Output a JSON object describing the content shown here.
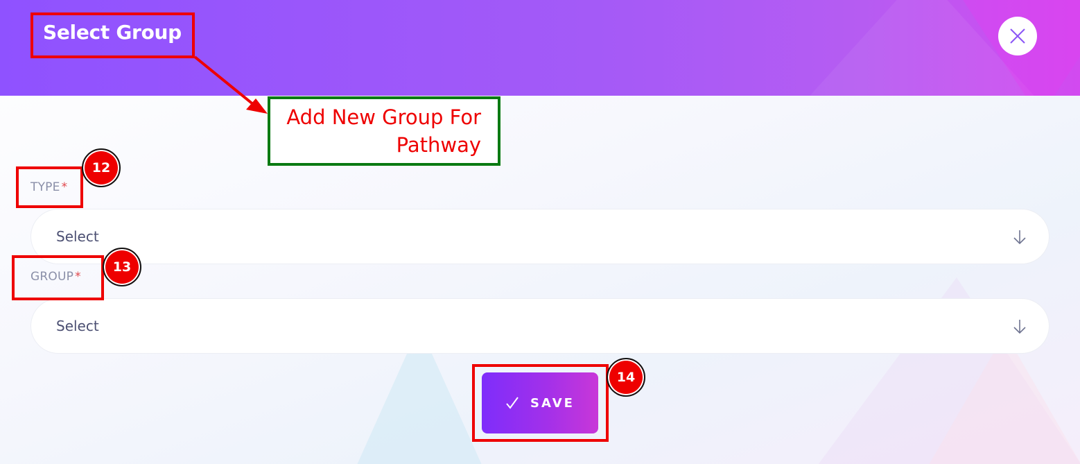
{
  "dialog": {
    "title": "Select Group",
    "close_icon": "close-icon"
  },
  "form": {
    "type": {
      "label": "TYPE",
      "required_mark": "*",
      "value": "Select",
      "arrow_icon": "arrow-down-icon"
    },
    "group": {
      "label": "GROUP",
      "required_mark": "*",
      "value": "Select",
      "arrow_icon": "arrow-down-icon"
    },
    "save": {
      "label": "SAVE",
      "icon": "checkmark-icon"
    }
  },
  "annotations": {
    "note_line1": "Add New Group For",
    "note_line2": "Pathway",
    "badges": [
      "12",
      "13",
      "14"
    ],
    "colors": {
      "box": "#ee0000",
      "note_border": "#0a7a12"
    }
  },
  "colors": {
    "header_start": "#8f52ff",
    "header_end": "#d24af0",
    "save_start": "#7e2dfb",
    "save_end": "#c837d8"
  }
}
